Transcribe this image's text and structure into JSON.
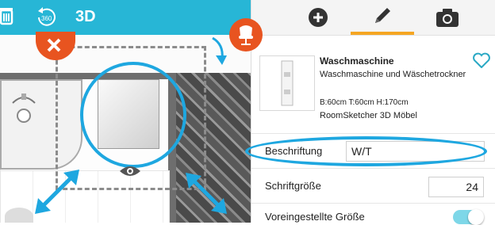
{
  "toolbar": {
    "view_3d_label": "3D",
    "rotate_label": "360"
  },
  "panel": {
    "tabs": [
      {
        "icon": "plus-circle-icon"
      },
      {
        "icon": "pencil-icon",
        "active": true
      },
      {
        "icon": "camera-icon"
      }
    ],
    "item": {
      "name": "Waschmaschine",
      "description": "Waschmaschine und Wäschetrockner",
      "dimensions": "B:60cm T:60cm H:170cm",
      "brand": "RoomSketcher 3D Möbel"
    },
    "label_field": {
      "label": "Beschriftung",
      "value": "W/T"
    },
    "font_size_field": {
      "label": "Schriftgröße",
      "value": "24"
    },
    "default_size": {
      "label": "Voreingestellte Größe",
      "checked": true
    }
  },
  "colors": {
    "toolbar_bg": "#27b6d6",
    "accent_orange": "#e85420",
    "highlight_blue": "#1ea7e0",
    "active_tab": "#f5a623"
  }
}
